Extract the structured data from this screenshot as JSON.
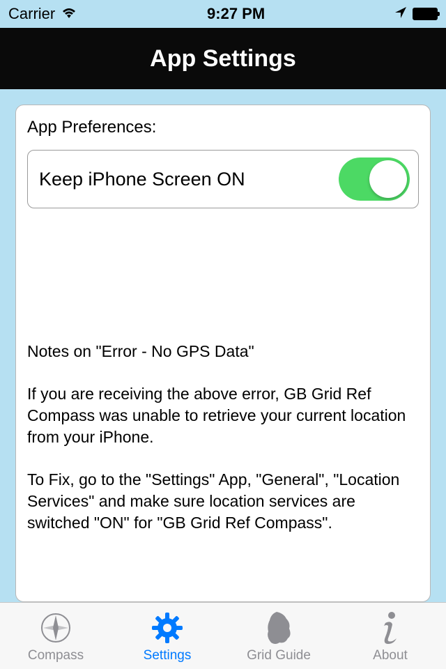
{
  "status": {
    "carrier": "Carrier",
    "time": "9:27 PM"
  },
  "nav": {
    "title": "App Settings"
  },
  "preferences": {
    "section_label": "App Preferences:",
    "keep_screen_on": {
      "label": "Keep iPhone Screen ON",
      "value": true
    }
  },
  "notes": {
    "heading": "Notes on \"Error - No GPS Data\"",
    "para1": "If you are receiving the above error, GB Grid Ref Compass was unable to retrieve your current location from your iPhone.",
    "para2": "To Fix, go to the \"Settings\" App, \"General\", \"Location Services\" and make sure location services are switched \"ON\" for \"GB Grid Ref Compass\"."
  },
  "tabs": {
    "items": [
      {
        "label": "Compass",
        "active": false
      },
      {
        "label": "Settings",
        "active": true
      },
      {
        "label": "Grid Guide",
        "active": false
      },
      {
        "label": "About",
        "active": false
      }
    ]
  },
  "colors": {
    "accent": "#007aff",
    "switch_on": "#4cd964",
    "background": "#b6e0f2"
  }
}
